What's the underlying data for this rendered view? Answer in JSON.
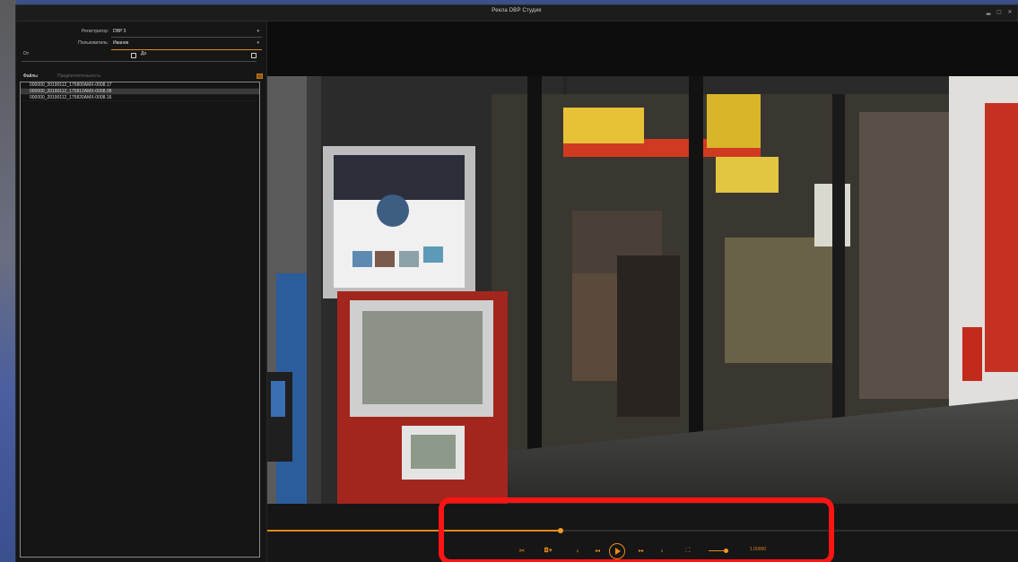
{
  "window": {
    "title": "Рекла DBP Студия",
    "controls": [
      "minimize-icon",
      "restore-icon",
      "close-icon"
    ]
  },
  "sidebar": {
    "recorder_label": "Регистратор:",
    "recorder_value": "DBP 3",
    "user_label": "Пользователь:",
    "user_value": "Иванов",
    "from_label": "От",
    "to_label": "До",
    "tabs": [
      {
        "label": "Файлы",
        "active": true
      },
      {
        "label": "Предпочтительность",
        "active": false
      }
    ],
    "files": [
      {
        "name": "000000_20190112_175800AMX-0008.17",
        "selected": false
      },
      {
        "name": "000000_20190112_175812AMX-0008.08",
        "selected": true
      },
      {
        "name": "000000_20190112_175820AMX-0008.16",
        "selected": false
      }
    ]
  },
  "player": {
    "progress": 0.39,
    "speed_value": "1.00000",
    "buttons": [
      "scissors-icon",
      "camera-icon",
      "step-back-icon",
      "rewind-icon",
      "play-icon",
      "fast-forward-icon",
      "step-forward-icon",
      "fullscreen-icon"
    ]
  },
  "colors": {
    "accent": "#e08a1c",
    "highlight": "#ff1414",
    "background": "#121212"
  }
}
